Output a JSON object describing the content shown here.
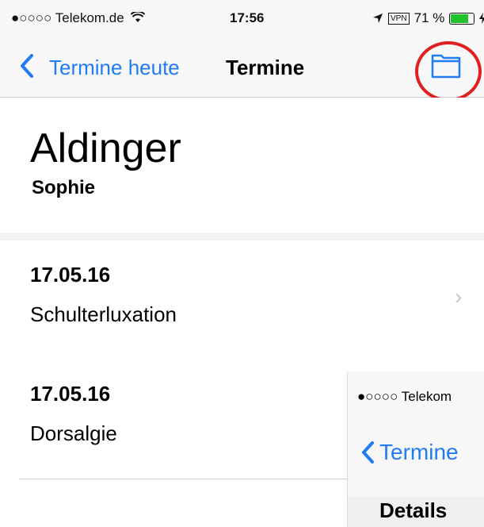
{
  "status_bar": {
    "carrier": "●○○○○ Telekom.de",
    "time": "17:56",
    "vpn": "VPN",
    "battery": "71 %",
    "battery_level": 0.71
  },
  "nav": {
    "back_label": "Termine heute",
    "title": "Termine",
    "highlight_color": "#e02020",
    "accent_color": "#1f7bf6"
  },
  "patient": {
    "last_name": "Aldinger",
    "first_name": "Sophie"
  },
  "appointments": [
    {
      "date": "17.05.16",
      "diagnosis": "Schulterluxation"
    },
    {
      "date": "17.05.16",
      "diagnosis": "Dorsalgie"
    }
  ],
  "overlay": {
    "carrier": "●○○○○ Telekom",
    "back_label": "Termine",
    "section_title": "Details"
  }
}
